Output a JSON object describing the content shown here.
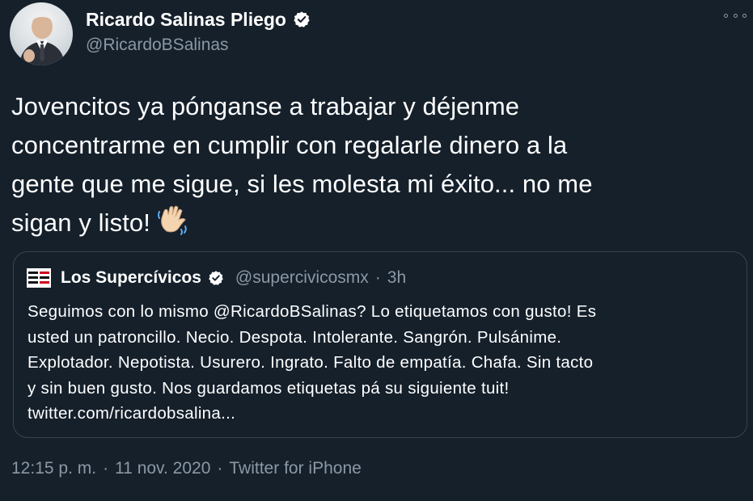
{
  "author": {
    "display_name": "Ricardo Salinas Pliego",
    "handle": "@RicardoBSalinas",
    "verified": true
  },
  "tweet": {
    "lines": [
      "Jovencitos ya pónganse a trabajar y déjenme",
      "concentrarme en cumplir con regalarle dinero a la",
      "gente que me sigue, si les molesta mi éxito... no me",
      "sigan y listo!"
    ],
    "emoji": "waving-hand-icon"
  },
  "quoted": {
    "display_name": "Los Supercívicos",
    "handle": "@supercivicosmx",
    "separator": "·",
    "time": "3h",
    "lines": [
      "Seguimos con lo mismo @RicardoBSalinas? Lo etiquetamos con gusto! Es",
      "usted un patroncillo. Necio. Despota. Intolerante. Sangrón. Pulsánime.",
      "Explotador. Nepotista. Usurero. Ingrato. Falto de empatía. Chafa. Sin tacto",
      "y sin buen gusto. Nos guardamos etiquetas pá su siguiente tuit!",
      "twitter.com/ricardobsalina..."
    ]
  },
  "meta": {
    "time": "12:15 p. m.",
    "date": "11 nov. 2020",
    "source": "Twitter for iPhone",
    "separator": "·"
  },
  "colors": {
    "background": "#15202b",
    "secondary_text": "#8b98a5",
    "border": "#38444d",
    "verified_badge": "#ffffff"
  }
}
